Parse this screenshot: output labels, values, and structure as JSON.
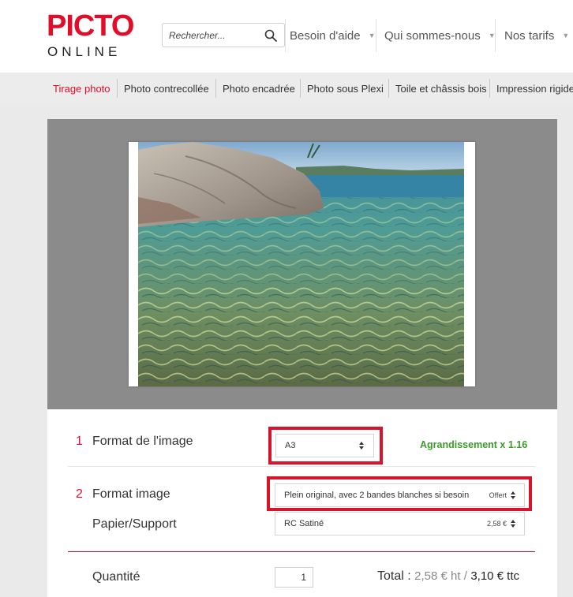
{
  "logo": {
    "brand": "PICTO",
    "sub": "ONLINE"
  },
  "search": {
    "placeholder": "Rechercher..."
  },
  "topnav": [
    {
      "label": "Besoin d'aide"
    },
    {
      "label": "Qui sommes-nous"
    },
    {
      "label": "Nos tarifs"
    }
  ],
  "categories": [
    {
      "label": "Tirage photo"
    },
    {
      "label": "Photo contrecollée"
    },
    {
      "label": "Photo encadrée"
    },
    {
      "label": "Photo sous Plexi"
    },
    {
      "label": "Toile et châssis bois"
    },
    {
      "label": "Impression rigide"
    }
  ],
  "form": {
    "step1": {
      "num": "1",
      "label": "Format de l'image",
      "value": "A3",
      "enlargement": "Agrandissement x 1.16"
    },
    "step2": {
      "num": "2",
      "label": "Format image",
      "value": "Plein original, avec 2 bandes blanches si besoin",
      "price": "Offert"
    },
    "paper": {
      "label": "Papier/Support",
      "value": "RC Satiné",
      "price": "2,58 €"
    },
    "quantity": {
      "label": "Quantité",
      "value": "1"
    },
    "total": {
      "label": "Total :",
      "ht": "2,58 € ht /",
      "ttc": "3,10 € ttc"
    }
  },
  "colors": {
    "brand_red": "#e30d2a",
    "highlight_red": "#d6142b",
    "enlargement_green": "#3c9a2b"
  }
}
